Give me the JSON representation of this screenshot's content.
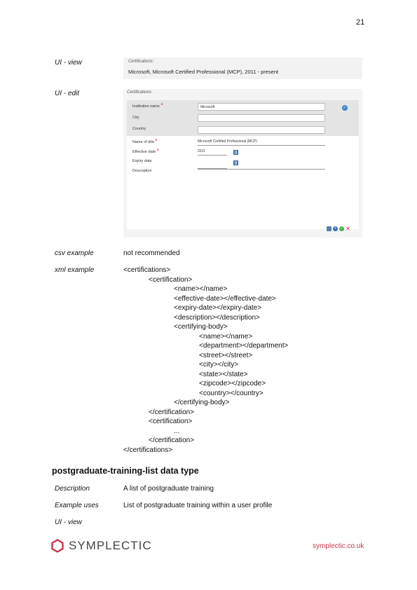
{
  "page_number": "21",
  "ui_view": {
    "label": "UI - view",
    "box_title": "Certifications:",
    "line": "Microsoft, Microsoft Certified Professional (MCP), 2011 - present"
  },
  "ui_edit": {
    "label": "UI - edit",
    "box_title": "Certifications:",
    "fields": {
      "institution_label": "Institution name",
      "institution_value": "Microsoft",
      "city_label": "City",
      "country_label": "Country",
      "name_label": "Name of title",
      "name_value": "Microsoft Certified Professional (MCP)",
      "effective_label": "Effective date",
      "effective_value": "2011",
      "expiry_label": "Expiry date",
      "description_label": "Description"
    },
    "required_mark": "*"
  },
  "csv": {
    "label": "csv example",
    "value": "not recommended"
  },
  "xml": {
    "label": "xml example",
    "lines": [
      "<certifications>",
      "<certification>",
      "<name></name>",
      "<effective-date></effective-date>",
      "<expiry-date></expiry-date>",
      "<description></description>",
      "<certifying-body>",
      "<name></name>",
      "<department></department>",
      "<street></street>",
      "<city></city>",
      "<state></state>",
      "<zipcode></zipcode>",
      "<country></country>",
      "</certifying-body>",
      "</certification>",
      "<certification>",
      "...",
      "</certification>",
      "</certifications>"
    ]
  },
  "section": {
    "heading": "postgraduate-training-list data type",
    "description_label": "Description",
    "description_value": "A list of postgraduate training",
    "example_label": "Example uses",
    "example_value": "List of postgraduate training within a user profile",
    "ui_view_label": "UI - view"
  },
  "footer": {
    "logo_text": "SYMPLECTIC",
    "link": "symplectic.co.uk",
    "brand_color": "#c6364f"
  }
}
